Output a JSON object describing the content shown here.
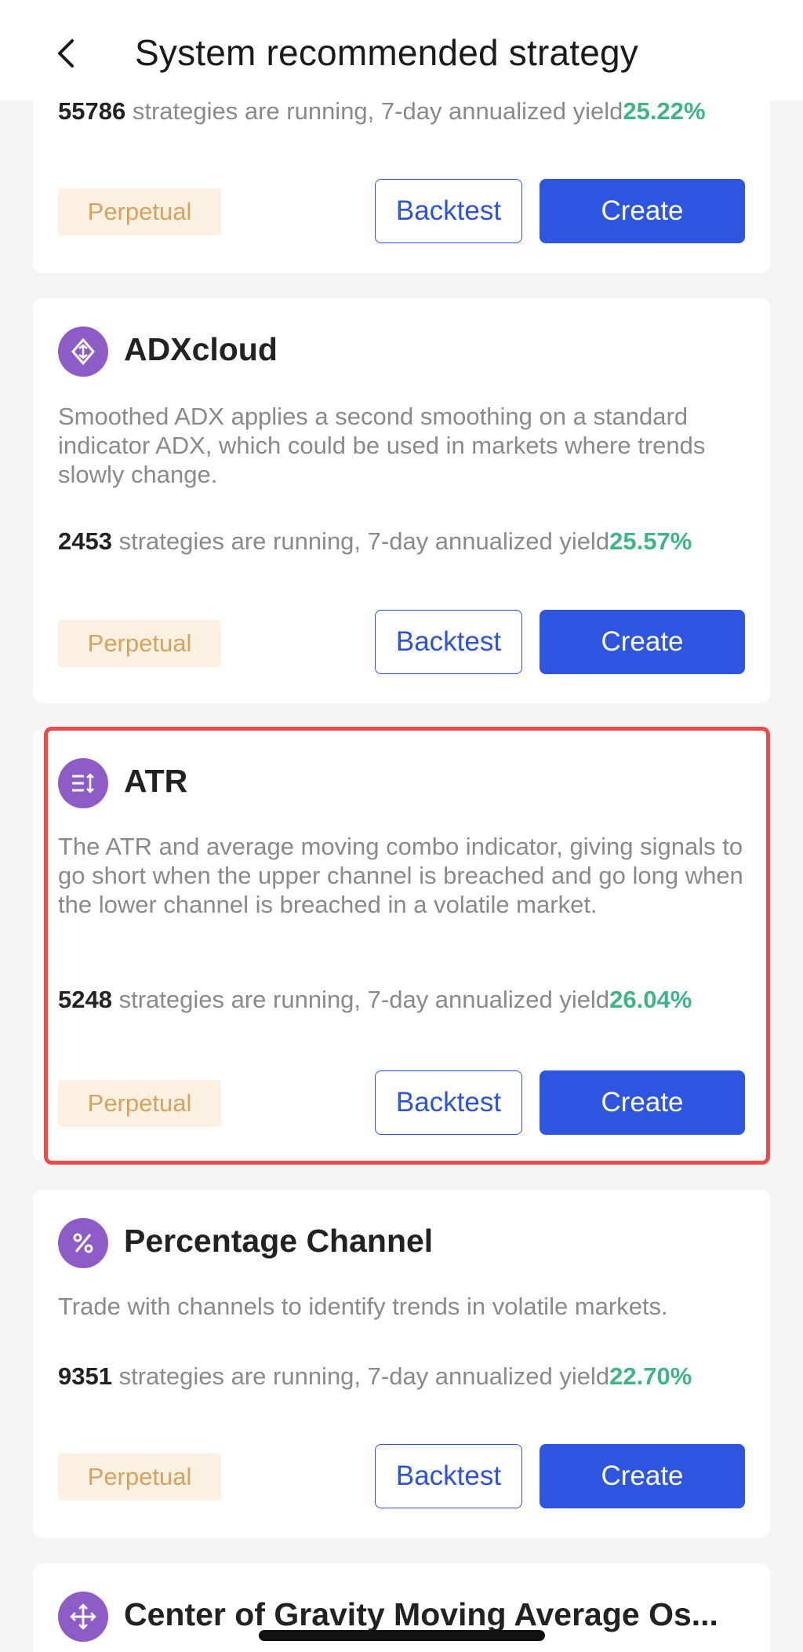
{
  "header": {
    "title": "System recommended strategy",
    "back_icon": "chevron-left-icon"
  },
  "colors": {
    "accent": "#2d55e0",
    "yield_green": "#3fb488",
    "icon_purple": "#8e5cc7",
    "tag_bg": "#fbf1e3",
    "tag_text": "#d6a25c",
    "highlight_red": "#ec4b4b"
  },
  "strategies": [
    {
      "name": "",
      "description": "",
      "running_count": "55786",
      "running_text": " strategies are running, 7-day annualized yield",
      "yield": "25.22%",
      "tag": "Perpetual",
      "backtest_label": "Backtest",
      "create_label": "Create"
    },
    {
      "name": "ADXcloud",
      "icon": "diamond-arrows-icon",
      "description": "Smoothed ADX  applies a second smoothing on a standard indicator ADX, which could be  used in markets where trends slowly change.",
      "running_count": "2453",
      "running_text": " strategies are running, 7-day annualized yield",
      "yield": "25.57%",
      "tag": "Perpetual",
      "backtest_label": "Backtest",
      "create_label": "Create"
    },
    {
      "name": "ATR",
      "icon": "list-sort-icon",
      "description": "The ATR and average moving combo indicator, giving signals to go short when the upper channel is breached and  go long when the lower channel is breached in a volatile market.",
      "running_count": "5248",
      "running_text": " strategies are running, 7-day annualized yield",
      "yield": "26.04%",
      "tag": "Perpetual",
      "backtest_label": "Backtest",
      "create_label": "Create",
      "highlighted": true
    },
    {
      "name": "Percentage Channel",
      "icon": "percent-icon",
      "description": "Trade with channels to identify trends in volatile markets.",
      "running_count": "9351",
      "running_text": " strategies are running, 7-day annualized yield",
      "yield": "22.70%",
      "tag": "Perpetual",
      "backtest_label": "Backtest",
      "create_label": "Create"
    },
    {
      "name": "Center of Gravity Moving Average Os...",
      "icon": "move-arrows-icon"
    }
  ]
}
